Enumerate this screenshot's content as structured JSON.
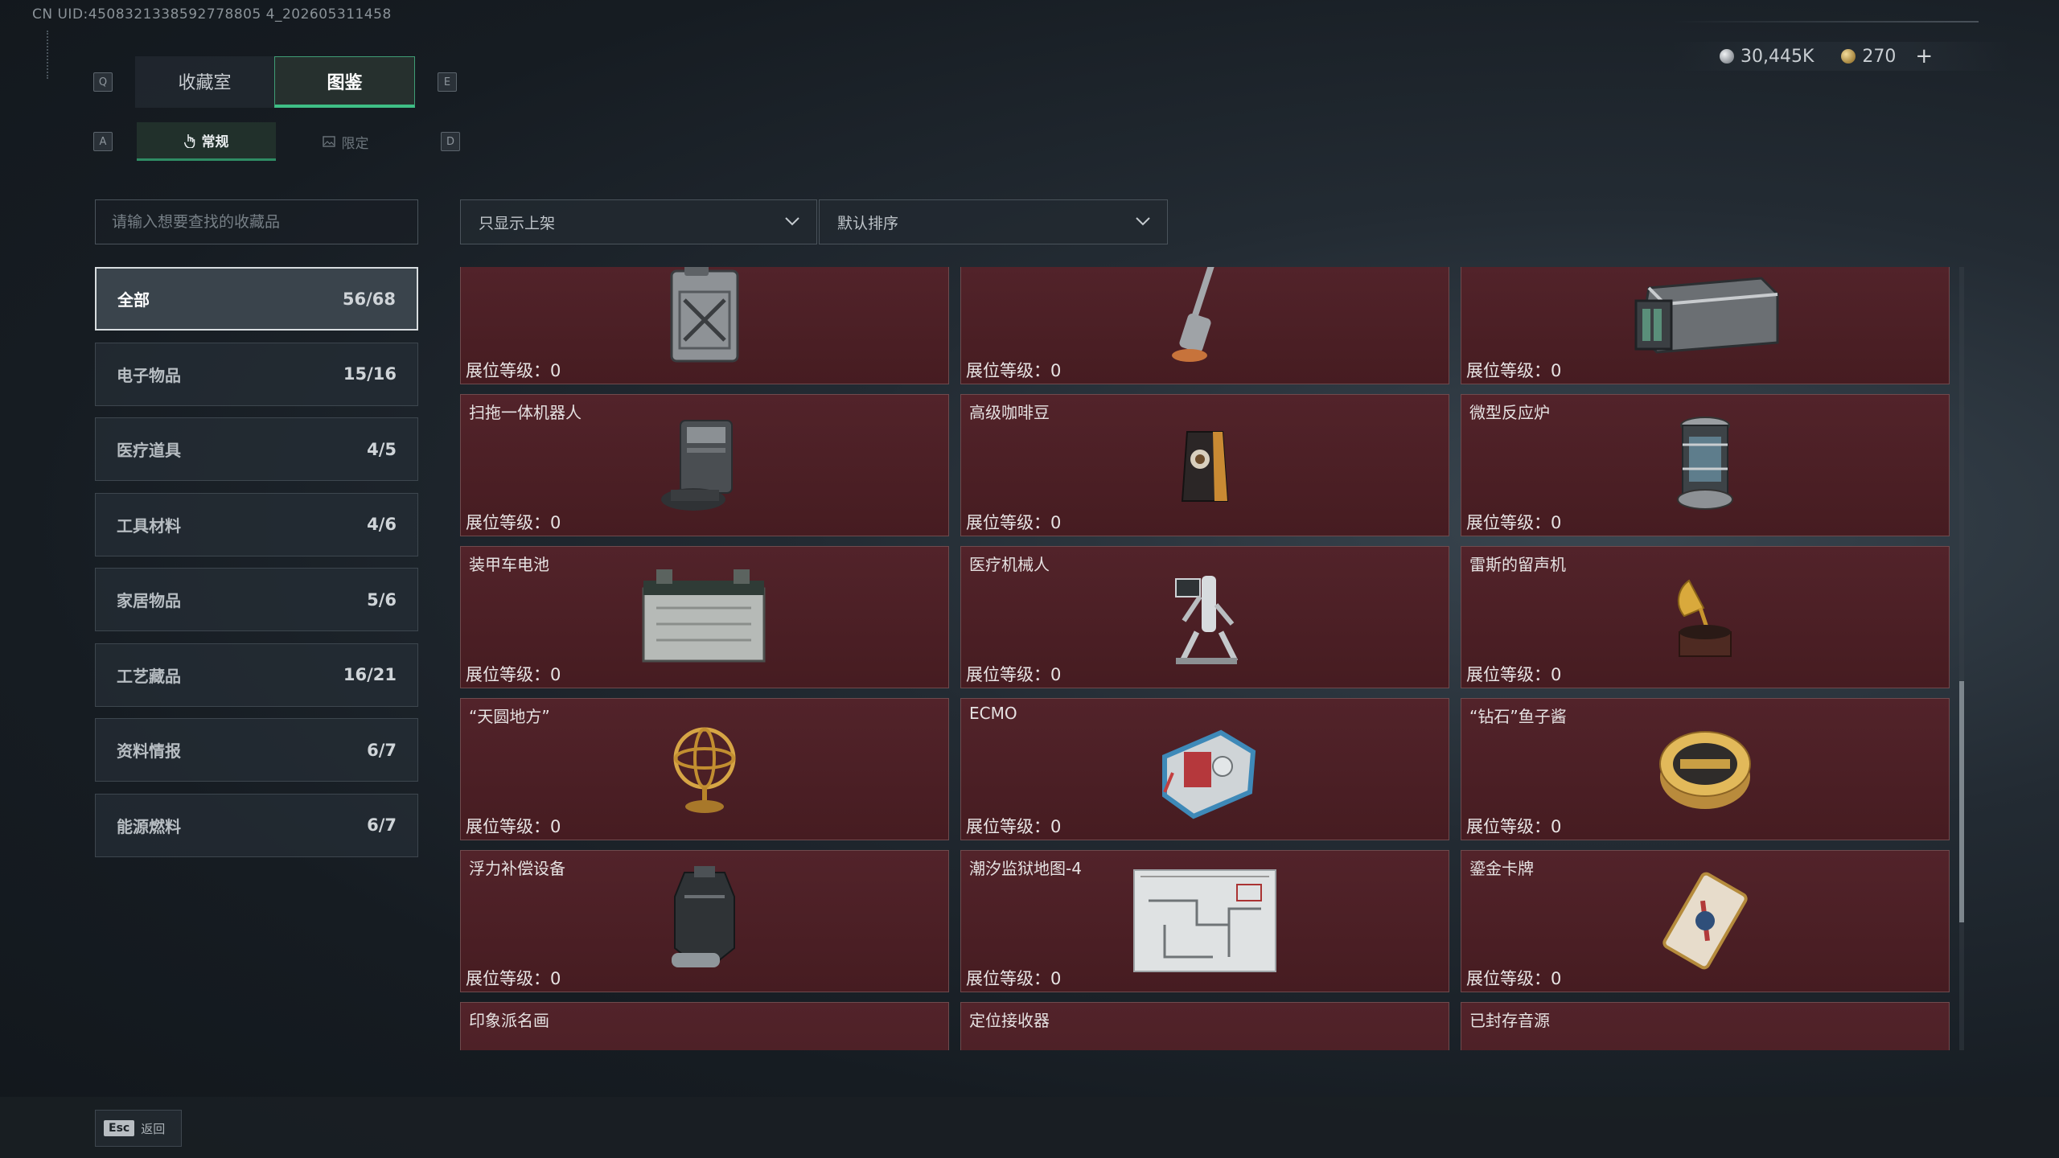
{
  "uid_text": "CN UID:4508321338592778805 4_202605311458",
  "keys": {
    "q": "Q",
    "e": "E",
    "a": "A",
    "d": "D"
  },
  "main_tabs": [
    {
      "label": "收藏室",
      "active": false
    },
    {
      "label": "图鉴",
      "active": true
    }
  ],
  "sub_tabs": [
    {
      "label": "常规",
      "icon": "hand-icon",
      "active": true
    },
    {
      "label": "限定",
      "icon": "image-icon",
      "active": false
    }
  ],
  "currency": {
    "silver": "30,445K",
    "gold": "270",
    "plus": "+"
  },
  "search": {
    "placeholder": "请输入想要查找的收藏品"
  },
  "filters": {
    "shelf": "只显示上架",
    "sort": "默认排序"
  },
  "categories": [
    {
      "label": "全部",
      "count": "56/68",
      "active": true
    },
    {
      "label": "电子物品",
      "count": "15/16"
    },
    {
      "label": "医疗道具",
      "count": "4/5"
    },
    {
      "label": "工具材料",
      "count": "4/6"
    },
    {
      "label": "家居物品",
      "count": "5/6"
    },
    {
      "label": "工艺藏品",
      "count": "16/21"
    },
    {
      "label": "资料情报",
      "count": "6/7"
    },
    {
      "label": "能源燃料",
      "count": "6/7"
    }
  ],
  "level_label": "展位等级：0",
  "items": [
    {
      "name": "",
      "icon": "fuel-can-icon"
    },
    {
      "name": "",
      "icon": "floor-washer-icon"
    },
    {
      "name": "",
      "icon": "server-unit-icon"
    },
    {
      "name": "扫拖一体机器人",
      "icon": "robot-vacuum-icon"
    },
    {
      "name": "高级咖啡豆",
      "icon": "coffee-bag-icon"
    },
    {
      "name": "微型反应炉",
      "icon": "reactor-icon"
    },
    {
      "name": "装甲车电池",
      "icon": "battery-icon"
    },
    {
      "name": "医疗机械人",
      "icon": "medical-robot-icon"
    },
    {
      "name": "雷斯的留声机",
      "icon": "gramophone-icon"
    },
    {
      "name": "“天圆地方”",
      "icon": "armillary-sphere-icon"
    },
    {
      "name": "ECMO",
      "icon": "ecmo-machine-icon"
    },
    {
      "name": "“钻石”鱼子酱",
      "icon": "caviar-tin-icon"
    },
    {
      "name": "浮力补偿设备",
      "icon": "buoyancy-vest-icon"
    },
    {
      "name": "潮汐监狱地图-4",
      "icon": "map-icon"
    },
    {
      "name": "鎏金卡牌",
      "icon": "gold-card-icon"
    },
    {
      "name": "印象派名画",
      "icon": "painting-icon"
    },
    {
      "name": "定位接收器",
      "icon": "receiver-icon"
    },
    {
      "name": "已封存音源",
      "icon": "tape-reel-icon"
    }
  ],
  "footer": {
    "esc_key": "Esc",
    "back_label": "返回"
  }
}
